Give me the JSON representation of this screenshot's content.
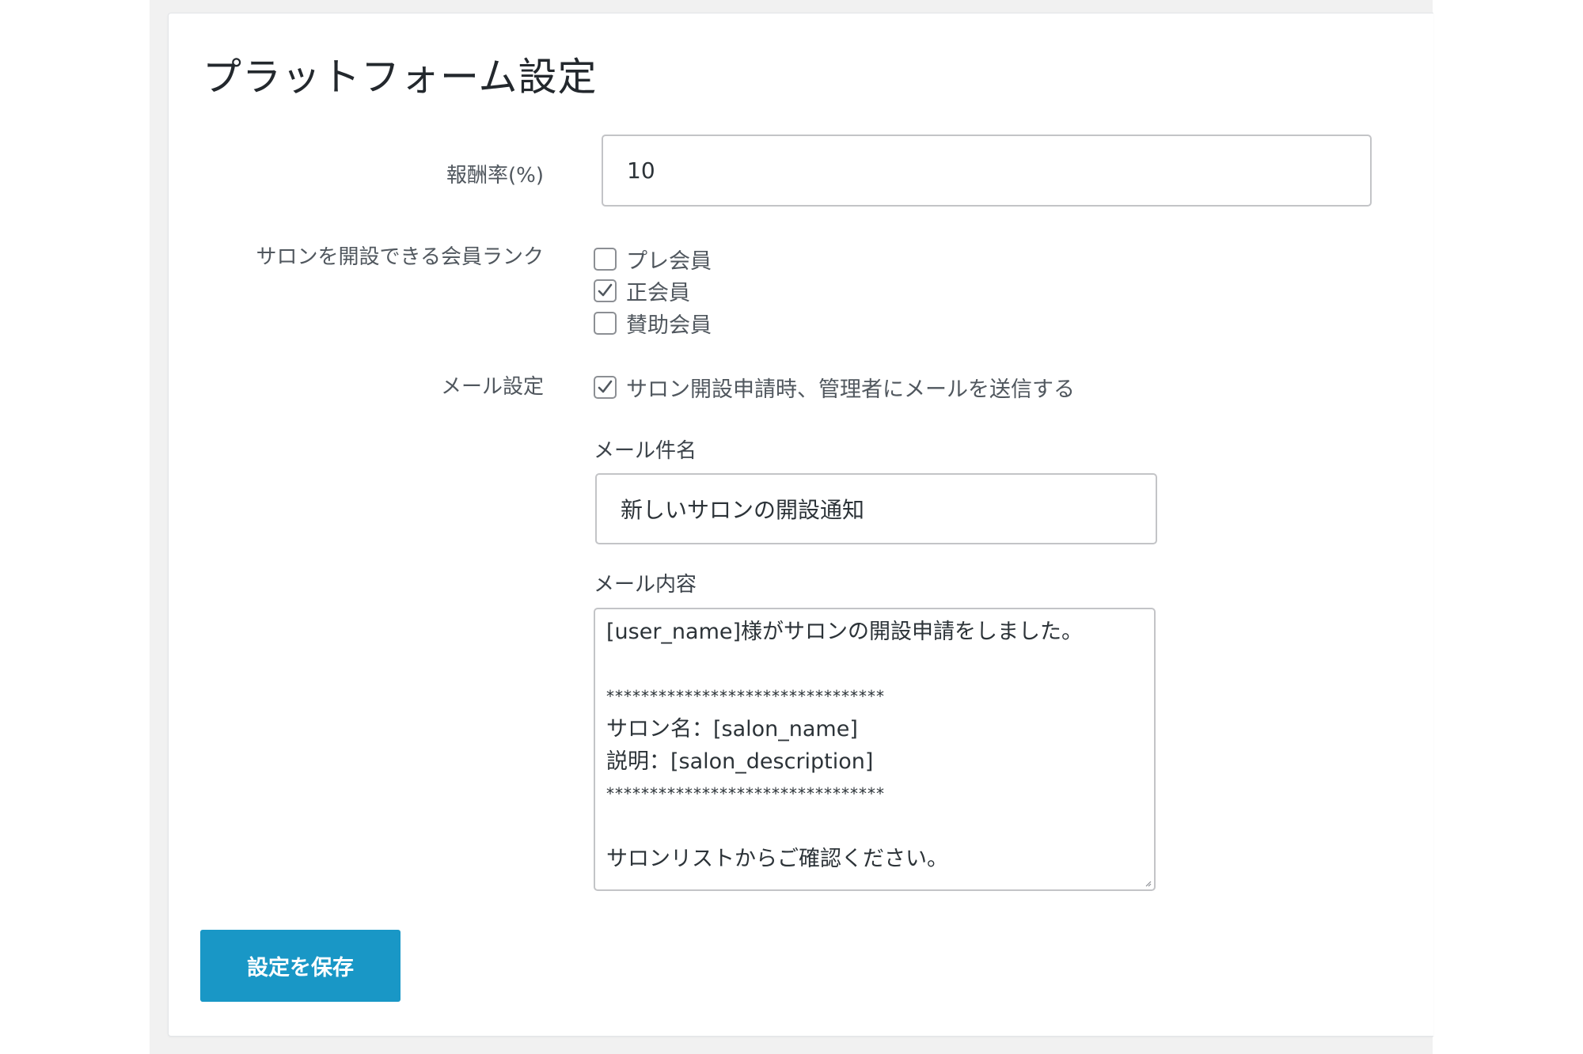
{
  "page": {
    "title": "プラットフォーム設定"
  },
  "fields": {
    "reward_rate": {
      "label": "報酬率(%)",
      "value": "10"
    },
    "member_rank": {
      "label": "サロンを開設できる会員ランク",
      "options": [
        {
          "label": "プレ会員",
          "checked": false
        },
        {
          "label": "正会員",
          "checked": true
        },
        {
          "label": "賛助会員",
          "checked": false
        }
      ]
    },
    "mail_settings": {
      "label": "メール設定",
      "notify_label": "サロン開設申請時、管理者にメールを送信する",
      "notify_checked": true,
      "subject_label": "メール件名",
      "subject_value": "新しいサロンの開設通知",
      "body_label": "メール内容",
      "body_lines": [
        "[user_name]様がサロンの開設申請をしました。",
        "",
        "********************************",
        "サロン名：[salon_name]",
        "説明：[salon_description]",
        "********************************",
        "",
        "サロンリストからご確認ください。"
      ]
    }
  },
  "actions": {
    "save_label": "設定を保存"
  },
  "colors": {
    "primary_button": "#1997c6",
    "page_background": "#f1f1f1",
    "panel_background": "#ffffff"
  }
}
